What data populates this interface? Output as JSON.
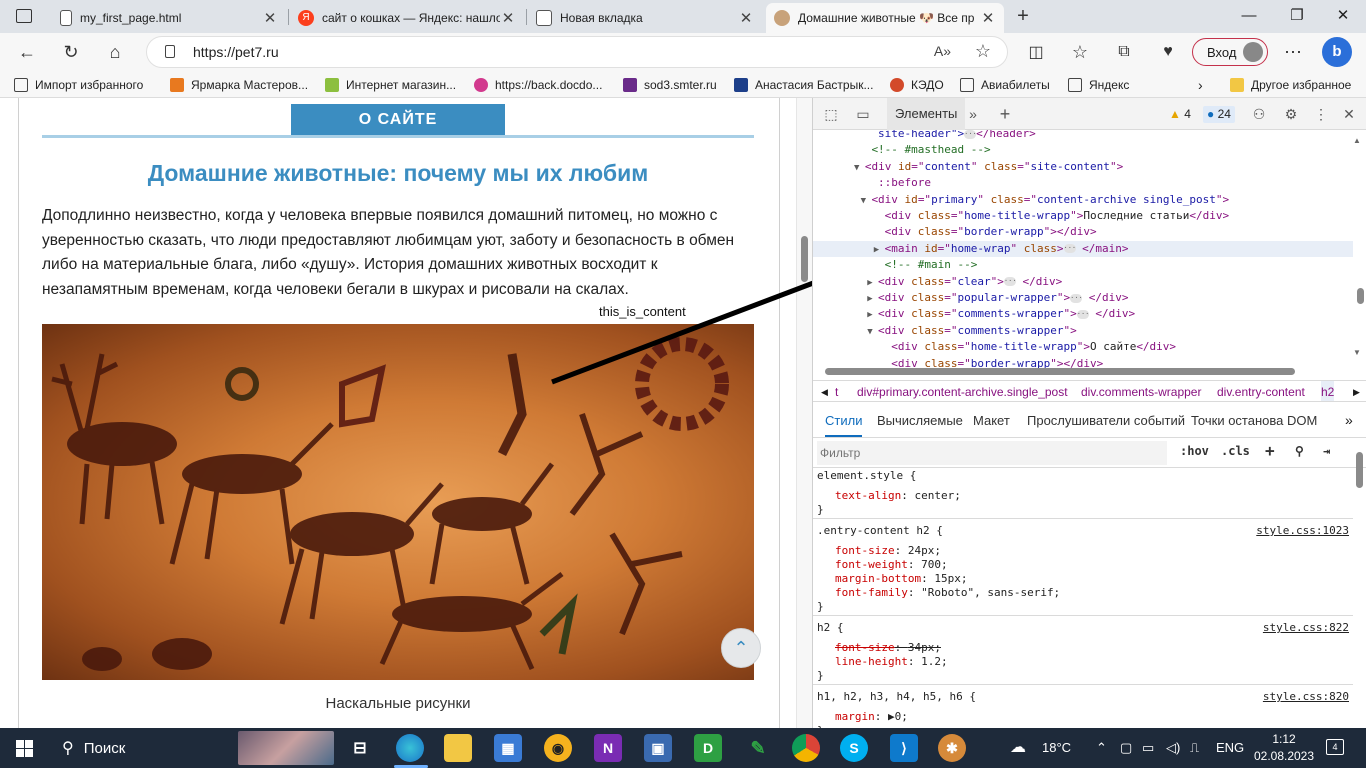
{
  "browser": {
    "tabs": [
      {
        "label": "my_first_page.html"
      },
      {
        "label": "сайт о кошках — Яндекс: нашло"
      },
      {
        "label": "Новая вкладка"
      },
      {
        "label": "Домашние животные 🐶 Все пр"
      }
    ],
    "url": "https://pet7.ru",
    "login_label": "Вход",
    "favorites": [
      "Импорт избранного",
      "Ярмарка Мастеров...",
      "Интернет магазин...",
      "https://back.docdo...",
      "sod3.smter.ru",
      "Анастасия Бастрык...",
      "КЭДО",
      "Авиабилеты",
      "Яндекс",
      "Другое избранное"
    ]
  },
  "page": {
    "section_tab": "О САЙТЕ",
    "title": "Домашние животные: почему мы их любим",
    "paragraph": "Доподлинно  неизвестно, когда у человека впервые появился домашний питомец, но можно с уверенностью сказать, что люди предоставляют любимцам уют, заботу и безопасность в обмен либо на материальные блага, либо «душу». История домашних животных восходит к незапамятным временам, когда человеки бегали в шкурах и рисовали на скалах.",
    "overlay_label": "this_is_content",
    "image_caption": "Наскальные рисунки",
    "scroll_top_icon": "chevron-up-icon"
  },
  "devtools": {
    "elements_tab": "Элементы",
    "warnings_count": "4",
    "messages_count": "24",
    "dom_lines": [
      {
        "indent": 7,
        "tri": "",
        "html": "site-header\">",
        "kind": "cut"
      },
      {
        "indent": 6,
        "tri": "",
        "comment": "<!-- #masthead -->"
      },
      {
        "indent": 5,
        "tri": "▼",
        "open": "div",
        "attrs": [
          [
            "id",
            "content"
          ],
          [
            "class",
            "site-content"
          ]
        ]
      },
      {
        "indent": 7,
        "tri": "",
        "pseudo": "::before"
      },
      {
        "indent": 6,
        "tri": "▼",
        "open": "div",
        "attrs": [
          [
            "id",
            "primary"
          ],
          [
            "class",
            "content-archive single_post"
          ]
        ]
      },
      {
        "indent": 8,
        "tri": "",
        "open": "div",
        "attrs": [
          [
            "class",
            "home-title-wrapp"
          ]
        ],
        "text": "Последние статьи",
        "close": "div"
      },
      {
        "indent": 8,
        "tri": "",
        "open": "div",
        "attrs": [
          [
            "class",
            "border-wrapp"
          ]
        ],
        "close": "div"
      },
      {
        "indent": 8,
        "tri": "▶",
        "open": "main",
        "attrs": [
          [
            "id",
            "home-wrap"
          ]
        ],
        "trail": " class",
        "dots": true,
        "close": "main",
        "hl": true
      },
      {
        "indent": 8,
        "tri": "",
        "comment": "<!-- #main -->"
      },
      {
        "indent": 7,
        "tri": "▶",
        "open": "div",
        "attrs": [
          [
            "class",
            "clear"
          ]
        ],
        "dots": true,
        "close": "div"
      },
      {
        "indent": 7,
        "tri": "▶",
        "open": "div",
        "attrs": [
          [
            "class",
            "popular-wrapper"
          ]
        ],
        "dots": true,
        "close": "div"
      },
      {
        "indent": 7,
        "tri": "▶",
        "open": "div",
        "attrs": [
          [
            "class",
            "comments-wrapper"
          ]
        ],
        "dots": true,
        "close": "div"
      },
      {
        "indent": 7,
        "tri": "▼",
        "open": "div",
        "attrs": [
          [
            "class",
            "comments-wrapper"
          ]
        ]
      },
      {
        "indent": 9,
        "tri": "",
        "open": "div",
        "attrs": [
          [
            "class",
            "home-title-wrapp"
          ]
        ],
        "text": "О сайте",
        "close": "div"
      },
      {
        "indent": 9,
        "tri": "",
        "open": "div",
        "attrs": [
          [
            "class",
            "border-wrapp"
          ]
        ],
        "close": "div",
        "kind": "cutbottom"
      }
    ],
    "breadcrumbs": [
      "t",
      "div#primary.content-archive.single_post",
      "div.comments-wrapper",
      "div.entry-content",
      "h2"
    ],
    "styles_tabs": [
      "Стили",
      "Вычисляемые",
      "Макет",
      "Прослушиватели событий",
      "Точки останова DOM"
    ],
    "filter_placeholder": "Фильтр",
    "hov": ":hov",
    "cls": ".cls",
    "rules": [
      {
        "selector": "element.style {",
        "source": "",
        "props": [
          [
            "text-align",
            "center",
            false
          ]
        ]
      },
      {
        "selector": ".entry-content h2 {",
        "source": "style.css:1023",
        "props": [
          [
            "font-size",
            "24px",
            false
          ],
          [
            "font-weight",
            "700",
            false
          ],
          [
            "margin-bottom",
            "15px",
            false
          ],
          [
            "font-family",
            "\"Roboto\", sans-serif",
            false
          ]
        ]
      },
      {
        "selector": "h2 {",
        "source": "style.css:822",
        "props": [
          [
            "font-size",
            "34px",
            true
          ],
          [
            "line-height",
            "1.2",
            false
          ]
        ]
      },
      {
        "selector": "h1, h2, h3, h4, h5, h6 {",
        "source": "style.css:820",
        "props": [
          [
            "margin",
            "▶0",
            false
          ]
        ]
      }
    ]
  },
  "taskbar": {
    "search_label": "Поиск",
    "weather": "18°C",
    "language": "ENG",
    "time": "1:12",
    "date": "02.08.2023",
    "notifications": "4"
  }
}
